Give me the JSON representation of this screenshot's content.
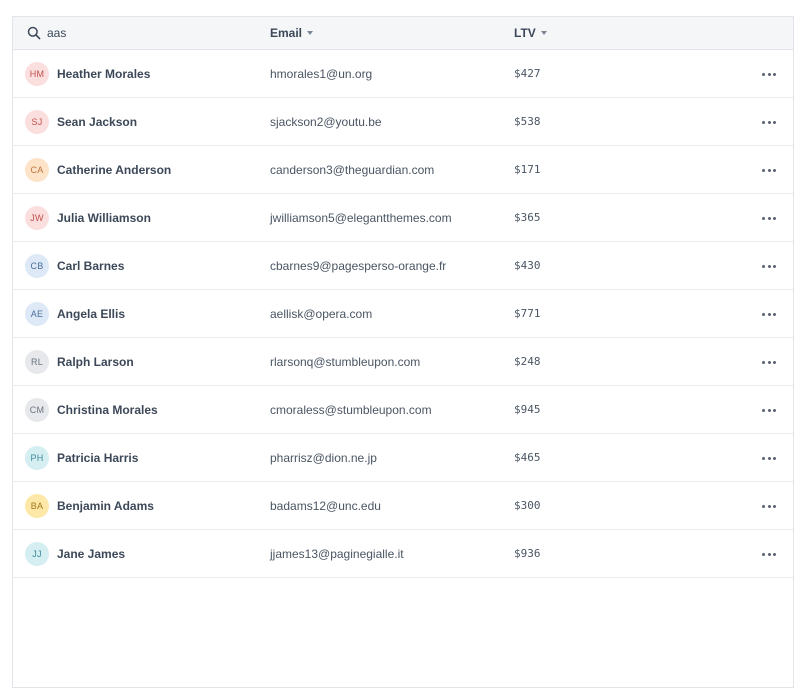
{
  "search": {
    "value": "aas",
    "placeholder": ""
  },
  "columns": {
    "email": "Email",
    "ltv": "LTV"
  },
  "rows": [
    {
      "initials": "HM",
      "name": "Heather Morales",
      "email": "hmorales1@un.org",
      "ltv": "$427",
      "avatar_bg": "#fbdfdf",
      "avatar_fg": "#c0504d"
    },
    {
      "initials": "SJ",
      "name": "Sean Jackson",
      "email": "sjackson2@youtu.be",
      "ltv": "$538",
      "avatar_bg": "#fbdfdf",
      "avatar_fg": "#c0504d"
    },
    {
      "initials": "CA",
      "name": "Catherine Anderson",
      "email": "canderson3@theguardian.com",
      "ltv": "$171",
      "avatar_bg": "#fde3c8",
      "avatar_fg": "#c0703a"
    },
    {
      "initials": "JW",
      "name": "Julia Williamson",
      "email": "jwilliamson5@elegantthemes.com",
      "ltv": "$365",
      "avatar_bg": "#fbdfdf",
      "avatar_fg": "#c0504d"
    },
    {
      "initials": "CB",
      "name": "Carl Barnes",
      "email": "cbarnes9@pagesperso-orange.fr",
      "ltv": "$430",
      "avatar_bg": "#dde9f7",
      "avatar_fg": "#4a6e99"
    },
    {
      "initials": "AE",
      "name": "Angela Ellis",
      "email": "aellisk@opera.com",
      "ltv": "$771",
      "avatar_bg": "#dde9f7",
      "avatar_fg": "#4a6e99"
    },
    {
      "initials": "RL",
      "name": "Ralph Larson",
      "email": "rlarsonq@stumbleupon.com",
      "ltv": "$248",
      "avatar_bg": "#e6e8eb",
      "avatar_fg": "#6b7480"
    },
    {
      "initials": "CM",
      "name": "Christina Morales",
      "email": "cmoraless@stumbleupon.com",
      "ltv": "$945",
      "avatar_bg": "#e6e8eb",
      "avatar_fg": "#6b7480"
    },
    {
      "initials": "PH",
      "name": "Patricia Harris",
      "email": "pharrisz@dion.ne.jp",
      "ltv": "$465",
      "avatar_bg": "#d4eef2",
      "avatar_fg": "#3b8a96"
    },
    {
      "initials": "BA",
      "name": "Benjamin Adams",
      "email": "badams12@unc.edu",
      "ltv": "$300",
      "avatar_bg": "#fde8a8",
      "avatar_fg": "#a07818"
    },
    {
      "initials": "JJ",
      "name": "Jane James",
      "email": "jjames13@paginegialle.it",
      "ltv": "$936",
      "avatar_bg": "#d4eef2",
      "avatar_fg": "#3b8a96"
    }
  ],
  "icons": {
    "search": "search-icon",
    "sort": "caret-down-icon",
    "more": "more-horizontal-icon"
  }
}
